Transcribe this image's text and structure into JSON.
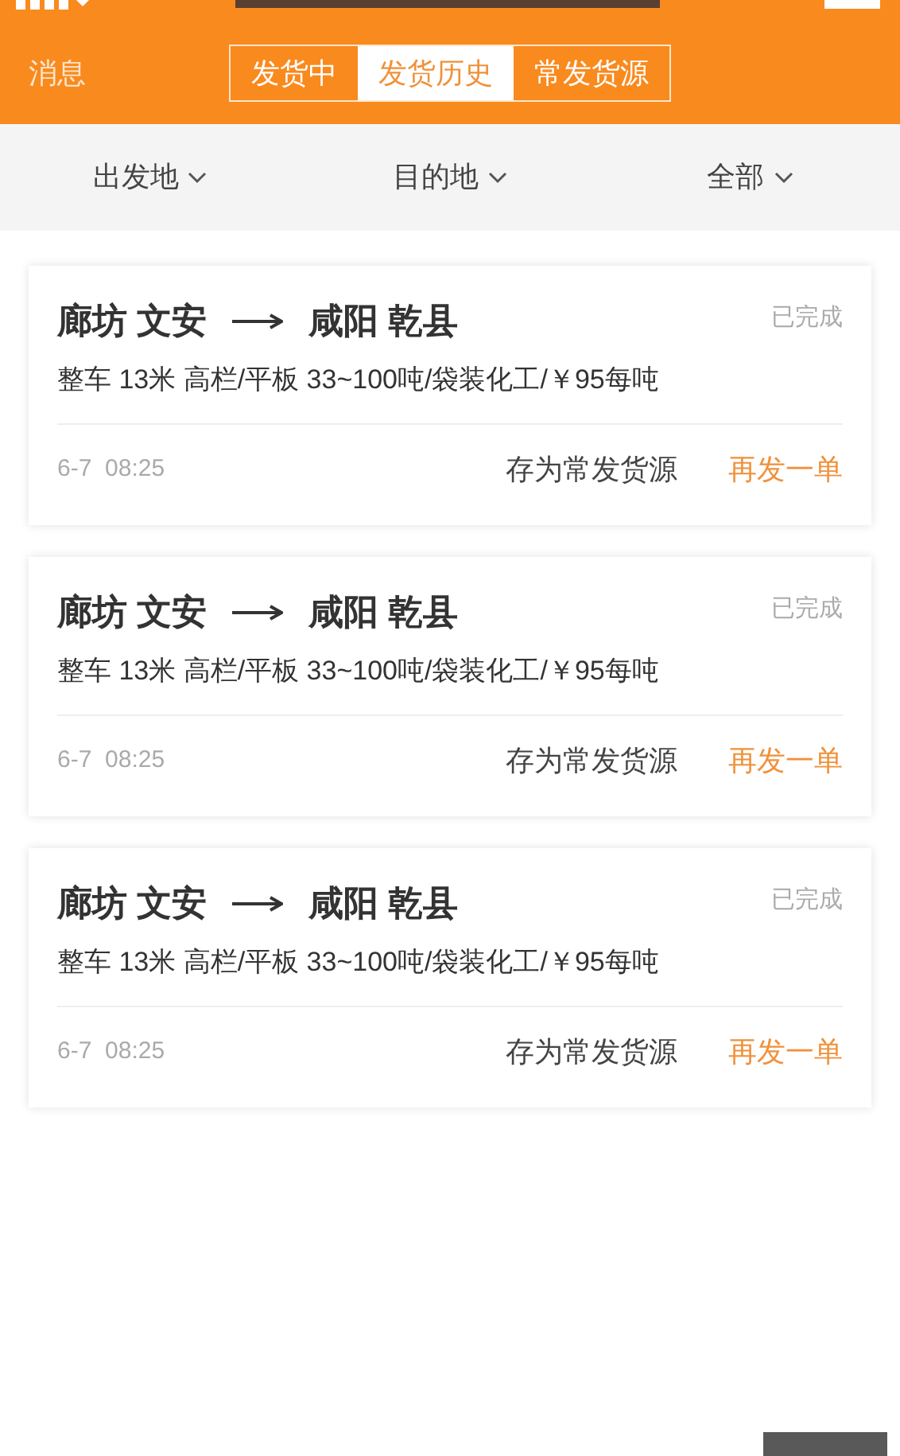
{
  "header": {
    "left_link": "消息",
    "tabs": [
      {
        "label": "发货中",
        "selected": false
      },
      {
        "label": "发货历史",
        "selected": true
      },
      {
        "label": "常发货源",
        "selected": false
      }
    ]
  },
  "filters": [
    {
      "label": "出发地"
    },
    {
      "label": "目的地"
    },
    {
      "label": "全部"
    }
  ],
  "orders": [
    {
      "origin": "廊坊 文安",
      "destination": "咸阳 乾县",
      "status": "已完成",
      "details": "整车 13米 高栏/平板 33~100吨/袋装化工/￥95每吨",
      "time": "6-7  08:25",
      "actions": [
        "存为常发货源",
        "再发一单"
      ]
    },
    {
      "origin": "廊坊 文安",
      "destination": "咸阳 乾县",
      "status": "已完成",
      "details": "整车 13米 高栏/平板 33~100吨/袋装化工/￥95每吨",
      "time": "6-7  08:25",
      "actions": [
        "存为常发货源",
        "再发一单"
      ]
    },
    {
      "origin": "廊坊 文安",
      "destination": "咸阳 乾县",
      "status": "已完成",
      "details": "整车 13米 高栏/平板 33~100吨/袋装化工/￥95每吨",
      "time": "6-7  08:25",
      "actions": [
        "存为常发货源",
        "再发一单"
      ]
    }
  ]
}
